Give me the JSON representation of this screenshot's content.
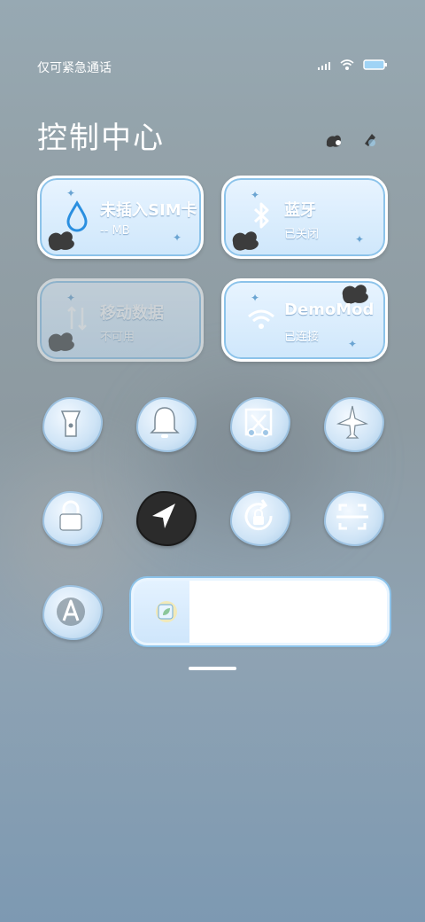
{
  "status": {
    "carrier_text": "仅可紧急通话",
    "signal_icon": "signal-icon",
    "wifi_icon": "wifi-icon",
    "battery_icon": "battery-icon"
  },
  "header": {
    "title": "控制中心",
    "icons": [
      "edit-icon",
      "settings-icon"
    ]
  },
  "tiles": [
    {
      "id": "data-usage",
      "line1": "未插入SIM卡",
      "line2": "-- MB",
      "icon": "water-drop-icon",
      "enabled": true
    },
    {
      "id": "bluetooth",
      "line1": "蓝牙",
      "line2": "已关闭",
      "icon": "bluetooth-icon",
      "enabled": true
    },
    {
      "id": "mobile-data",
      "line1": "移动数据",
      "line2": "不可用",
      "icon": "mobile-data-icon",
      "enabled": false
    },
    {
      "id": "wlan",
      "line1": "DemoMod",
      "line2": "已连接",
      "icon": "wifi-icon",
      "enabled": true
    }
  ],
  "toggles": [
    {
      "id": "flashlight",
      "icon": "flashlight-icon"
    },
    {
      "id": "ringer",
      "icon": "bell-icon"
    },
    {
      "id": "screenshot",
      "icon": "scissors-icon"
    },
    {
      "id": "airplane",
      "icon": "airplane-icon"
    },
    {
      "id": "lock-screen",
      "icon": "lock-icon"
    },
    {
      "id": "location",
      "icon": "location-icon"
    },
    {
      "id": "rotation-lock",
      "icon": "rotation-lock-icon"
    },
    {
      "id": "scanner",
      "icon": "scan-icon"
    },
    {
      "id": "auto-brightness",
      "icon": "auto-brightness-icon"
    }
  ],
  "brightness": {
    "level_fraction": 0.22,
    "icon": "brightness-icon"
  },
  "colors": {
    "accent": "#8cc3ea",
    "tile_text": "#ffffff",
    "drop_blue": "#2a8fe0"
  }
}
